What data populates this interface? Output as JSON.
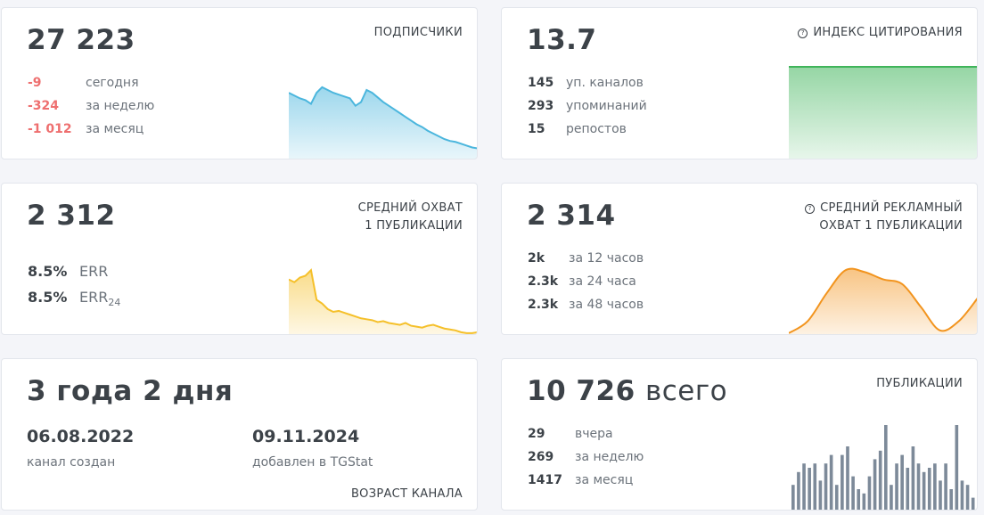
{
  "subscribers": {
    "value": "27 223",
    "label": "ПОДПИСЧИКИ",
    "rows": [
      {
        "value": "-9",
        "text": "сегодня"
      },
      {
        "value": "-324",
        "text": "за неделю"
      },
      {
        "value": "-1 012",
        "text": "за месяц"
      }
    ],
    "color": "#4bb6dd"
  },
  "citation": {
    "value": "13.7",
    "label": "ИНДЕКС ЦИТИРОВАНИЯ",
    "info_icon": "info-icon",
    "rows": [
      {
        "value": "145",
        "text": "уп. каналов"
      },
      {
        "value": "293",
        "text": "упоминаний"
      },
      {
        "value": "15",
        "text": "репостов"
      }
    ],
    "color": "#3fb45a"
  },
  "reach": {
    "value": "2 312",
    "label_line1": "СРЕДНИЙ ОХВАТ",
    "label_line2": "1 ПУБЛИКАЦИИ",
    "rows": [
      {
        "value": "8.5%",
        "text": "ERR"
      },
      {
        "value": "8.5%",
        "text": "ERR",
        "sub": "24"
      }
    ],
    "color": "#f5c02a"
  },
  "ad_reach": {
    "value": "2 314",
    "label_line1": "СРЕДНИЙ РЕКЛАМНЫЙ",
    "label_line2": "ОХВАТ 1 ПУБЛИКАЦИИ",
    "info_icon": "info-icon",
    "rows": [
      {
        "value": "2k",
        "text": "за 12 часов"
      },
      {
        "value": "2.3k",
        "text": "за 24 часа"
      },
      {
        "value": "2.3k",
        "text": "за 48 часов"
      }
    ],
    "color": "#f2941e"
  },
  "age": {
    "value": "3 года 2 дня",
    "created_date": "06.08.2022",
    "created_text": "канал создан",
    "added_date": "09.11.2024",
    "added_text": "добавлен в TGStat",
    "label": "ВОЗРАСТ КАНАЛА"
  },
  "posts": {
    "value": "10 726",
    "value_suffix": "всего",
    "label": "ПУБЛИКАЦИИ",
    "rows": [
      {
        "value": "29",
        "text": "вчера"
      },
      {
        "value": "269",
        "text": "за неделю"
      },
      {
        "value": "1417",
        "text": "за месяц"
      }
    ],
    "color": "#7d8a99"
  },
  "chart_data": [
    {
      "type": "area",
      "series": [
        {
          "values": [
            72,
            69,
            66,
            64,
            60,
            72,
            78,
            75,
            72,
            70,
            68,
            66,
            58,
            62,
            75,
            72,
            67,
            62,
            58,
            54,
            50,
            46,
            42,
            38,
            35,
            31,
            28,
            25,
            22,
            20,
            19,
            17,
            15,
            13,
            12
          ]
        }
      ]
    },
    {
      "type": "area",
      "series": [
        {
          "values": [
            100,
            100,
            100,
            100,
            100,
            100,
            100,
            100,
            100,
            100
          ]
        }
      ]
    },
    {
      "type": "area",
      "series": [
        {
          "values": [
            60,
            57,
            62,
            64,
            70,
            38,
            34,
            28,
            25,
            26,
            24,
            22,
            20,
            18,
            17,
            16,
            14,
            15,
            13,
            12,
            11,
            13,
            10,
            9,
            8,
            10,
            11,
            9,
            7,
            6,
            5,
            3,
            2,
            2,
            3
          ]
        }
      ]
    },
    {
      "type": "area",
      "series": [
        {
          "values": [
            2,
            15,
            45,
            70,
            68,
            60,
            55,
            30,
            5,
            15,
            40
          ]
        }
      ]
    },
    {
      "type": "bar",
      "values": [
        6,
        9,
        11,
        10,
        11,
        7,
        11,
        13,
        6,
        13,
        15,
        8,
        5,
        4,
        8,
        12,
        14,
        20,
        6,
        11,
        13,
        10,
        15,
        11,
        9,
        10,
        11,
        7,
        11,
        5,
        20,
        7,
        6,
        3
      ]
    }
  ]
}
